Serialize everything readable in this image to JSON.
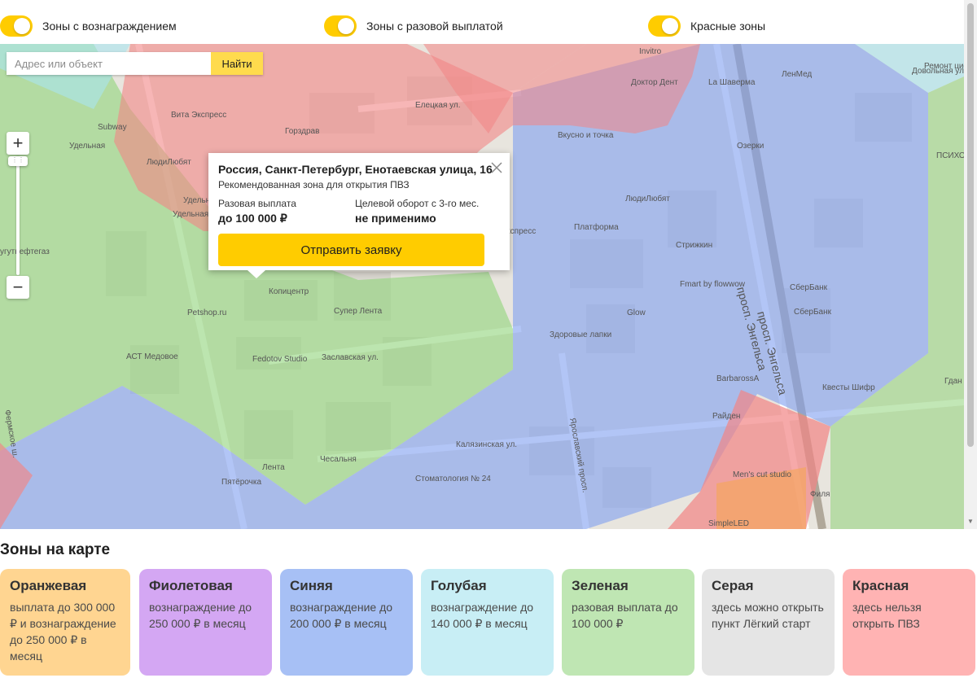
{
  "toggles": [
    {
      "label": "Зоны с вознаграждением",
      "on": true
    },
    {
      "label": "Зоны с разовой выплатой",
      "on": true
    },
    {
      "label": "Красные зоны",
      "on": true
    }
  ],
  "search": {
    "placeholder": "Адрес или объект",
    "button": "Найти"
  },
  "zoom": {
    "plus": "+",
    "minus": "−"
  },
  "map_labels": [
    "Удельная",
    "Вита Экспресс",
    "Subway",
    "Горздрав",
    "ЛюдиЛюбят",
    "Удельная вход",
    "Елецкая ул.",
    "Вкусно и точка",
    "Доктор Дент",
    "La Шаверма",
    "ЛенМед",
    "Озерки",
    "Ремонт цифровой техники",
    "ЛюдиЛюбят",
    "Платформа",
    "Стрижкин",
    "Fmart by flowwow",
    "СберБанк",
    "СберБанк",
    "Glow",
    "Здоровые лапки",
    "просп. Энгельса",
    "просп. Энгельса",
    "BarbarossA",
    "Квесты Шифр",
    "Райден",
    "Копицентр",
    "Супер Лента",
    "Petshop.ru",
    "Fedotov Studio",
    "Заславская ул.",
    "АСТ Медовое",
    "Лента",
    "Чесальня",
    "Пятёрочка",
    "Стоматология № 24",
    "Калязинская ул.",
    "Ярославский просп.",
    "Men's cut studio",
    "Филя",
    "SimpleLED",
    "Invitro",
    "Довольная улыбка",
    "ПСИХО",
    "Фермское ш.",
    "Удельная",
    "Суpер",
    "Экспресс",
    "Гдан",
    "угутнефтегаз"
  ],
  "popup": {
    "address": "Россия, Санкт-Петербург, Енотаевская улица, 16",
    "subtitle": "Рекомендованная зона для открытия ПВЗ",
    "one_time_label": "Разовая выплата",
    "one_time_value": "до 100 000 ₽",
    "turnover_label": "Целевой оборот с 3-го мес.",
    "turnover_value": "не применимо",
    "apply_button": "Отправить заявку"
  },
  "legend": {
    "title": "Зоны на карте",
    "cards": [
      {
        "name": "Оранжевая",
        "desc": "выплата до 300 000 ₽ и вознаграждение до 250 000 ₽ в месяц",
        "color": "#ffd591"
      },
      {
        "name": "Фиолетовая",
        "desc": "вознаграждение до 250 000 ₽ в месяц",
        "color": "#d4a7f3"
      },
      {
        "name": "Синяя",
        "desc": "вознаграждение до 200 000 ₽ в месяц",
        "color": "#a7c0f5"
      },
      {
        "name": "Голубая",
        "desc": "вознаграждение до 140 000 ₽ в месяц",
        "color": "#c8eef5"
      },
      {
        "name": "Зеленая",
        "desc": "разовая выплата до 100 000 ₽",
        "color": "#bfe6b3"
      },
      {
        "name": "Серая",
        "desc": "здесь можно открыть пункт Лёгкий старт",
        "color": "#e5e5e5"
      },
      {
        "name": "Красная",
        "desc": "здесь нельзя открыть ПВЗ",
        "color": "#ffb3b3"
      }
    ]
  },
  "colors": {
    "accent": "#ffcc00",
    "green_zone": "#8fd47a",
    "blue_zone": "#7f9ff0",
    "red_zone": "#f28585",
    "orange_zone": "#f5a65b"
  }
}
